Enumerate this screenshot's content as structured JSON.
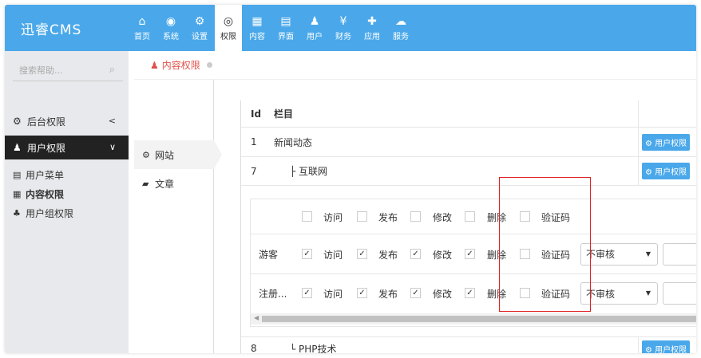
{
  "app": {
    "logo": "迅睿CMS"
  },
  "nav": [
    {
      "icon": "home-icon",
      "glyph": "⌂",
      "label": "首页"
    },
    {
      "icon": "globe-icon",
      "glyph": "◉",
      "label": "系统"
    },
    {
      "icon": "gears-icon",
      "glyph": "⚙",
      "label": "设置"
    },
    {
      "icon": "user-circle-icon",
      "glyph": "◎",
      "label": "权限",
      "active": true
    },
    {
      "icon": "grid-icon",
      "glyph": "▦",
      "label": "内容"
    },
    {
      "icon": "html5-icon",
      "glyph": "▤",
      "label": "界面"
    },
    {
      "icon": "user-icon",
      "glyph": "♟",
      "label": "用户"
    },
    {
      "icon": "yen-icon",
      "glyph": "¥",
      "label": "财务"
    },
    {
      "icon": "puzzle-icon",
      "glyph": "✚",
      "label": "应用"
    },
    {
      "icon": "cloud-icon",
      "glyph": "☁",
      "label": "服务"
    }
  ],
  "sidebar": {
    "search_placeholder": "搜索帮助...",
    "groups": [
      {
        "label": "后台权限",
        "icon": "gear-icon",
        "arrow": "<"
      },
      {
        "label": "用户权限",
        "icon": "user-icon",
        "arrow": "∨"
      }
    ],
    "items": [
      {
        "label": "用户菜单",
        "icon": "list-icon"
      },
      {
        "label": "内容权限",
        "icon": "grid-icon"
      },
      {
        "label": "用户组权限",
        "icon": "users-icon"
      }
    ]
  },
  "crumb": {
    "label": "内容权限"
  },
  "column_tree": [
    {
      "label": "网站",
      "icon": "gear-icon"
    },
    {
      "label": "文章",
      "icon": "note-icon"
    }
  ],
  "table": {
    "headers": {
      "id": "Id",
      "name": "栏目"
    },
    "button_label": "用户权限",
    "rows": [
      {
        "id": "1",
        "name": "新闻动态"
      },
      {
        "id": "7",
        "name": "├ 互联网"
      },
      {
        "id": "8",
        "name": "└ PHP技术"
      }
    ]
  },
  "perm": {
    "header_labels": [
      "访问",
      "发布",
      "修改",
      "删除",
      "验证码"
    ],
    "groups": [
      {
        "name": "游客",
        "checks": [
          true,
          true,
          true,
          true,
          false
        ],
        "labels": [
          "访问",
          "发布",
          "修改",
          "删除",
          "验证码"
        ],
        "select": "不审核"
      },
      {
        "name": "注册...",
        "checks": [
          true,
          true,
          true,
          true,
          false
        ],
        "labels": [
          "访问",
          "发布",
          "修改",
          "删除",
          "验证码"
        ],
        "select": "不审核"
      }
    ]
  }
}
